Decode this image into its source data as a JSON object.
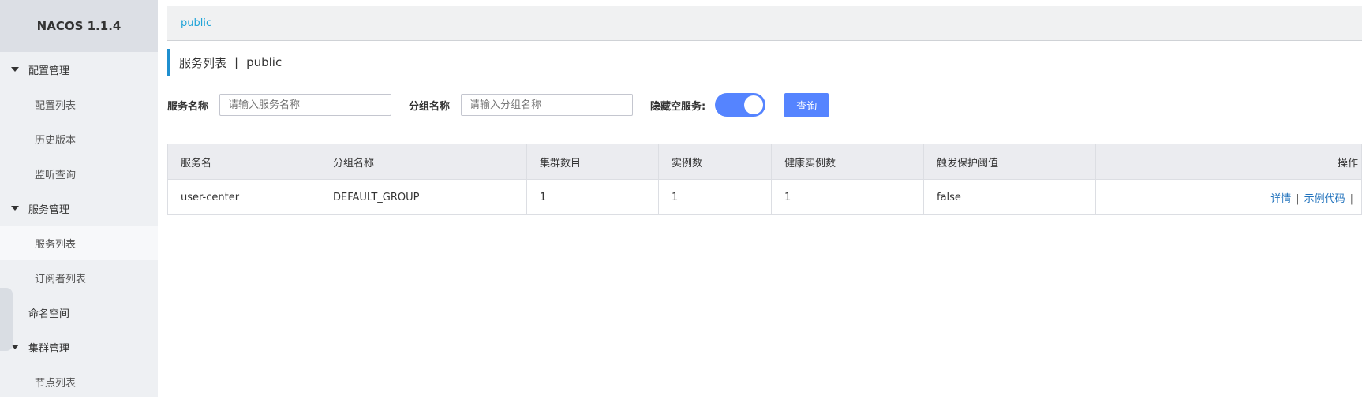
{
  "brand": {
    "title": "NACOS 1.1.4"
  },
  "sidebar": {
    "groups": [
      {
        "label": "配置管理",
        "items": [
          "配置列表",
          "历史版本",
          "监听查询"
        ]
      },
      {
        "label": "服务管理",
        "items": [
          "服务列表",
          "订阅者列表"
        ]
      },
      {
        "label": "命名空间"
      },
      {
        "label": "集群管理",
        "items": [
          "节点列表"
        ]
      }
    ]
  },
  "topbar": {
    "namespace": "public"
  },
  "page": {
    "title": "服务列表",
    "separator": "|",
    "namespace": "public"
  },
  "filters": {
    "service_label": "服务名称",
    "service_placeholder": "请输入服务名称",
    "group_label": "分组名称",
    "group_placeholder": "请输入分组名称",
    "hide_empty_label": "隐藏空服务:",
    "hide_empty_on": true,
    "query_button": "查询"
  },
  "table": {
    "headers": [
      "服务名",
      "分组名称",
      "集群数目",
      "实例数",
      "健康实例数",
      "触发保护阈值",
      "操作"
    ],
    "rows": [
      {
        "service": "user-center",
        "group": "DEFAULT_GROUP",
        "clusters": "1",
        "instances": "1",
        "healthy": "1",
        "protect": "false",
        "actions": [
          "详情",
          "示例代码"
        ]
      }
    ],
    "action_separator": "|"
  },
  "colors": {
    "accent": "#5584ff",
    "link": "#2273bd",
    "namespace_link": "#20a4d8",
    "title_bar": "#1f8fcf"
  }
}
